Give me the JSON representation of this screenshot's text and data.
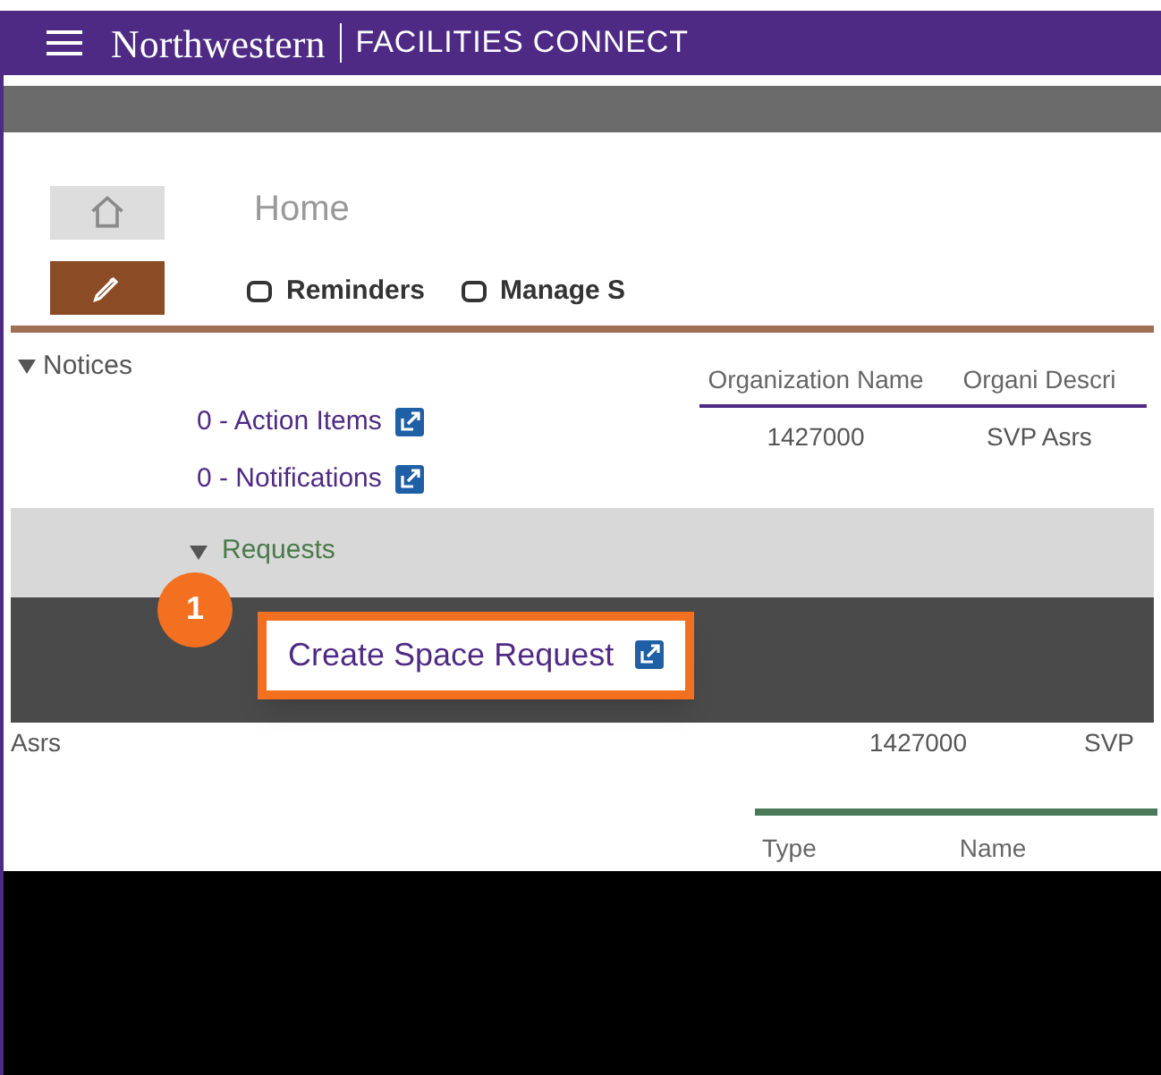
{
  "header": {
    "brand": "Northwestern",
    "product": "FACILITIES CONNECT"
  },
  "page_title": "Home",
  "tabs": [
    {
      "label": "Reminders",
      "selected": false
    },
    {
      "label": "Manage S",
      "selected": false
    }
  ],
  "notices": {
    "title": "Notices",
    "expanded": true,
    "items": [
      {
        "label": "0 - Action Items"
      },
      {
        "label": "0 - Notifications"
      }
    ]
  },
  "table": {
    "columns": [
      "Organization Name",
      "Organi Descri"
    ],
    "rows": [
      [
        "1427000",
        "SVP Asrs"
      ]
    ]
  },
  "requests": {
    "title": "Requests",
    "expanded": true
  },
  "callout": {
    "step": "1",
    "label": "Create Space Request"
  },
  "lower_row": [
    "Asrs",
    "1427000",
    "SVP"
  ],
  "lower_columns": [
    "Type",
    "Name"
  ]
}
